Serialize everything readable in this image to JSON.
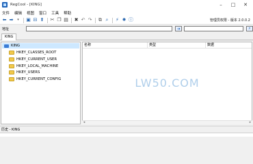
{
  "window": {
    "title": "RegCool - [KING]"
  },
  "menu": {
    "items": [
      "文件",
      "编辑",
      "视图",
      "窗口",
      "工具",
      "帮助"
    ]
  },
  "toolbar": {
    "version_text": "管理员权限 - 版本 2.0.0.2",
    "buttons": [
      "back-icon",
      "forward-icon",
      "dropdown-icon",
      "save-icon",
      "export-icon",
      "up-icon",
      "cut-icon",
      "copy-icon",
      "paste-icon",
      "delete-icon",
      "undo-icon",
      "redo-icon",
      "compare-icon",
      "find-icon",
      "jump-icon",
      "settings-icon",
      "info-icon"
    ]
  },
  "address": {
    "label": "地址",
    "value": ""
  },
  "tabs": [
    {
      "label": "KING"
    }
  ],
  "tree": {
    "root": "KING",
    "items": [
      "HKEY_CLASSES_ROOT",
      "HKEY_CURRENT_USER",
      "HKEY_LOCAL_MACHINE",
      "HKEY_USERS",
      "HKEY_CURRENT_CONFIG"
    ]
  },
  "list": {
    "columns": [
      "名称",
      "类型",
      "数据"
    ],
    "watermark": "LW50.COM"
  },
  "status": {
    "text": "历史 - KING"
  }
}
